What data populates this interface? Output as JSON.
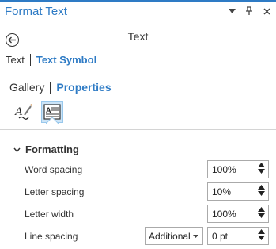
{
  "window": {
    "title": "Format Text",
    "controls": {
      "menu_icon": "dropdown-arrow-icon",
      "pin_icon": "pin-icon",
      "close_icon": "close-icon"
    }
  },
  "header": {
    "heading": "Text",
    "back_icon": "back-arrow-icon"
  },
  "breadcrumb": {
    "items": [
      "Text",
      "Text Symbol"
    ],
    "active_index": 1
  },
  "tabs": {
    "items": [
      "Gallery",
      "Properties"
    ],
    "active_index": 1
  },
  "symbol_tabs": [
    {
      "icon": "text-font-brush-icon",
      "selected": false
    },
    {
      "icon": "text-paragraph-icon",
      "selected": true
    }
  ],
  "section": {
    "label": "Formatting",
    "expanded": true
  },
  "properties": [
    {
      "label": "Word spacing",
      "value": "100%"
    },
    {
      "label": "Letter spacing",
      "value": "10%"
    },
    {
      "label": "Letter width",
      "value": "100%"
    },
    {
      "label": "Line spacing",
      "mode": "Additional",
      "value": "0 pt"
    }
  ],
  "colors": {
    "accent": "#2e7bc5",
    "selected_bg": "#cce4f7",
    "border": "#aaaaaa"
  }
}
